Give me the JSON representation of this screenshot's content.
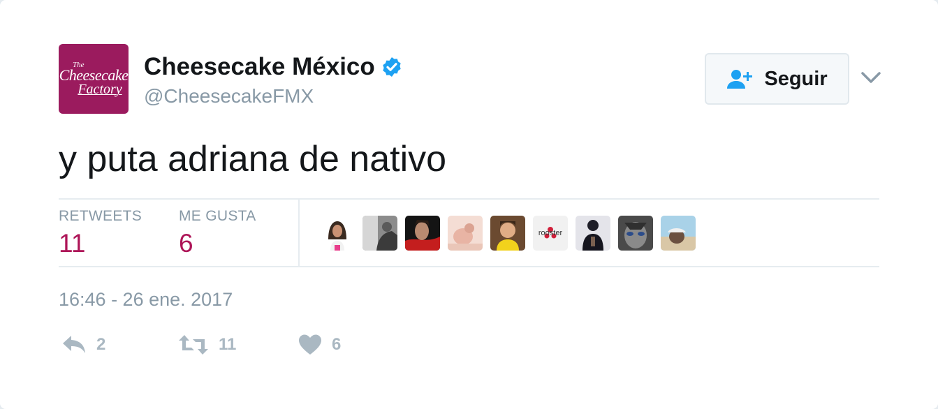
{
  "header": {
    "avatar_logo_text": {
      "line1": "The",
      "line2": "Cheesecake",
      "line3": "Factory"
    },
    "display_name": "Cheesecake México",
    "handle": "@CheesecakeFMX",
    "verified_icon": "verified-badge-icon",
    "follow_button_label": "Seguir",
    "follow_icon": "person-add-icon",
    "menu_icon": "chevron-down-icon"
  },
  "tweet": {
    "text": "y puta adriana de nativo"
  },
  "stats": {
    "retweets_label": "RETWEETS",
    "retweets_value": "11",
    "likes_label": "ME GUSTA",
    "likes_value": "6",
    "liker_avatars": [
      "avatar-1",
      "avatar-2",
      "avatar-3",
      "avatar-4",
      "avatar-5",
      "avatar-rooster",
      "avatar-7",
      "avatar-8",
      "avatar-9"
    ],
    "rooster_text": "rooster"
  },
  "timestamp": "16:46 - 26 ene. 2017",
  "actions": {
    "reply_count": "2",
    "retweet_count": "11",
    "like_count": "6"
  },
  "colors": {
    "brand_maroon": "#9b1b5e",
    "stat_value": "#ad1457",
    "verified_blue": "#1da1f2",
    "muted_gray": "#8899a6"
  }
}
